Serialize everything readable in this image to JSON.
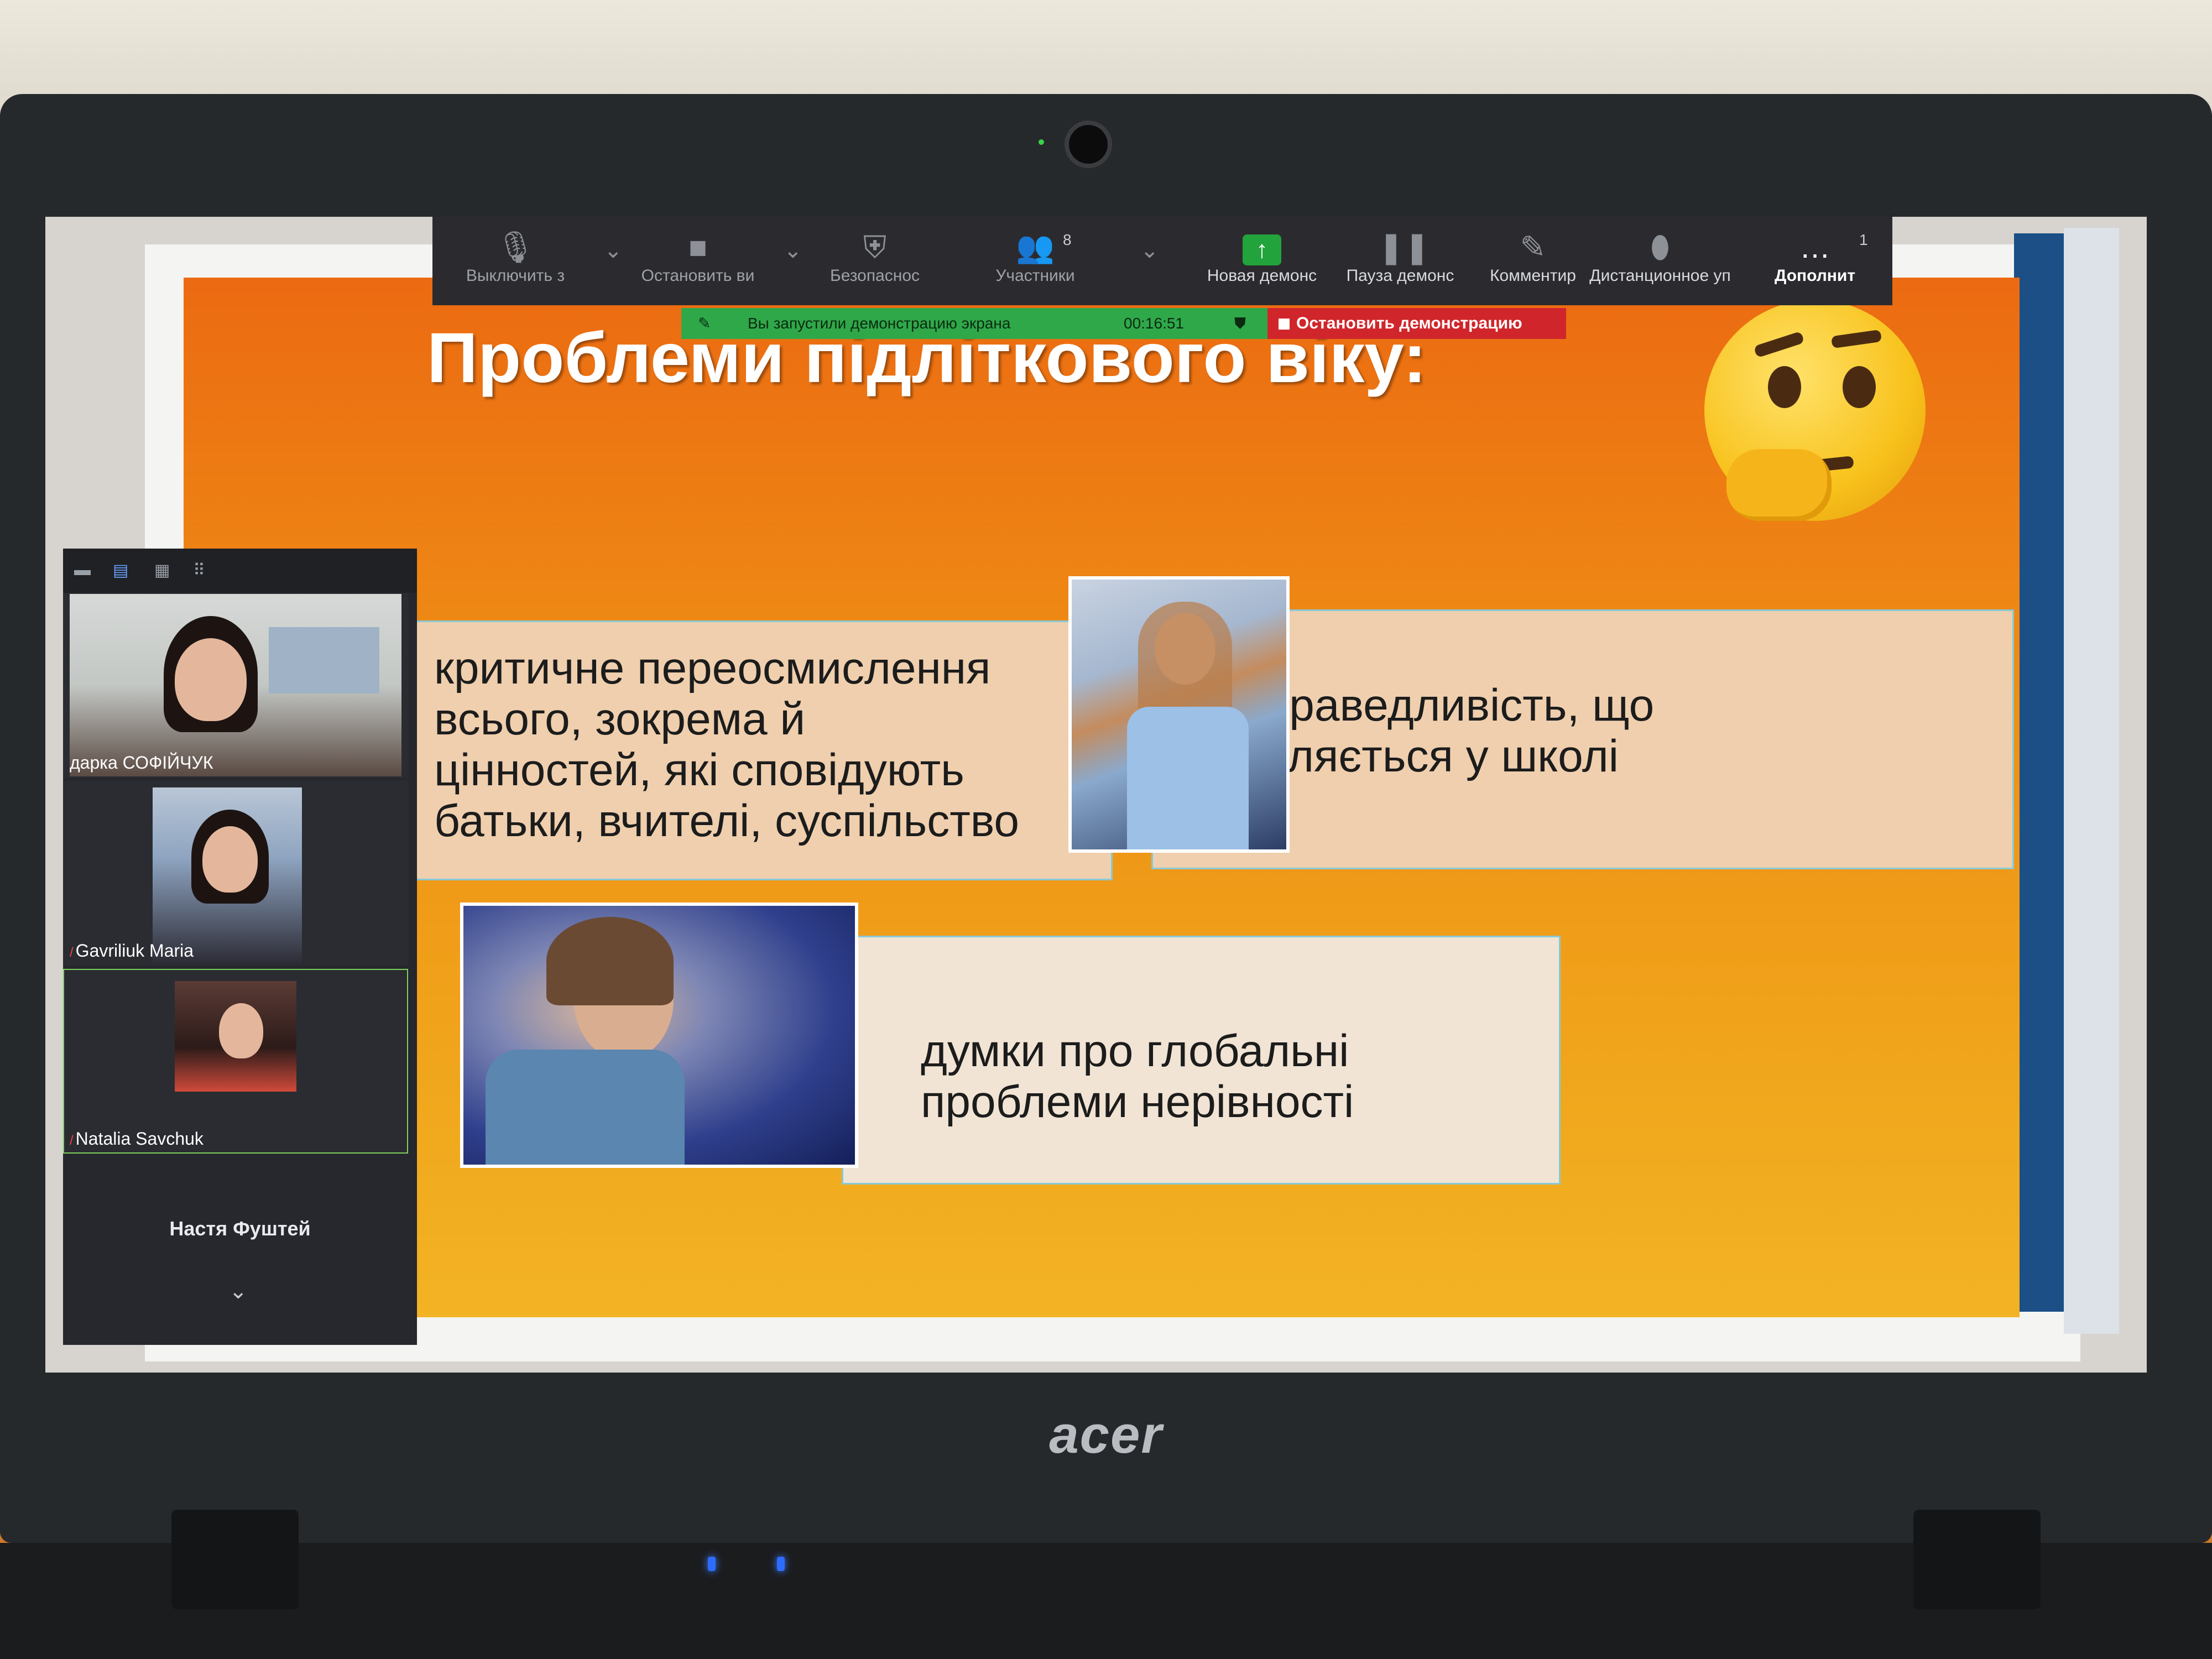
{
  "device": {
    "logo": "acer"
  },
  "zoom_toolbar": {
    "items": [
      {
        "label": "Выключить з",
        "icon": "microphone-icon"
      },
      {
        "label": "Остановить ви",
        "icon": "video-camera-icon"
      },
      {
        "label": "Безопаснос",
        "icon": "shield-icon"
      },
      {
        "label": "Участники",
        "icon": "participants-icon",
        "count": "8"
      },
      {
        "label": "Новая демонс",
        "icon": "share-screen-icon"
      },
      {
        "label": "Пауза демонс",
        "icon": "pause-icon"
      },
      {
        "label": "Комментир",
        "icon": "pencil-icon"
      },
      {
        "label": "Дистанционное уп",
        "icon": "mouse-icon"
      },
      {
        "label": "Дополнит",
        "icon": "more-icon",
        "count": "1"
      }
    ],
    "share_banner": {
      "message": "Вы запустили демонстрацию экрана",
      "timer": "00:16:51"
    },
    "stop_share": "Остановить демонстрацию"
  },
  "slide": {
    "title": "Проблеми підліткового віку:",
    "box1": [
      "критичне переосмислення",
      "всього, зокрема й",
      "цінностей, які сповідують",
      "батьки, вчителі, суспільство"
    ],
    "box2": [
      "несправедливість, що",
      "трапляється у школі"
    ],
    "box3": [
      "думки про глобальні",
      "проблеми нерівності"
    ]
  },
  "gallery": {
    "participants": [
      {
        "name": "дарка СОФІЙЧУК"
      },
      {
        "name": "Gavriliuk Maria"
      },
      {
        "name": "Natalia Savchuk"
      }
    ],
    "name_card": "Настя Фуштей"
  },
  "colors": {
    "slide_top": "#ec6a12",
    "slide_bottom": "#f2b324",
    "toolbar": "#2b2b2f",
    "share_green": "#2fa84a",
    "stop_red": "#d0262b"
  }
}
